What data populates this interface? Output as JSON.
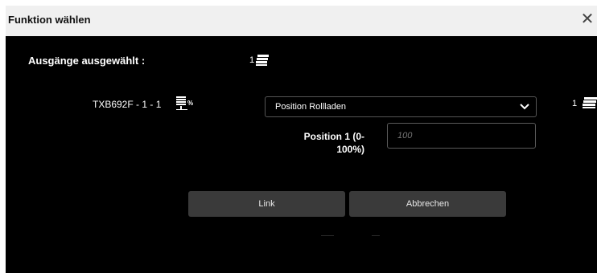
{
  "dialog": {
    "title": "Funktion wählen",
    "close_glyph": "✕"
  },
  "selected_outputs": {
    "label": "Ausgänge ausgewählt :",
    "count": "1",
    "icon": "output-stack-icon"
  },
  "device": {
    "label": "TXB692F - 1 - 1",
    "icon": "shutter-percent-icon"
  },
  "function_select": {
    "value": "Position Rollladen",
    "icon": "chevron-down-icon"
  },
  "right_count": "1",
  "position": {
    "label_line1": "Position 1 (0-",
    "label_line2": "100%)",
    "placeholder": "100"
  },
  "buttons": {
    "link": "Link",
    "cancel": "Abbrechen"
  },
  "colors": {
    "background": "#000000",
    "titlebar": "#f0f0f0",
    "button": "#3a3a3a",
    "text": "#ffffff"
  }
}
